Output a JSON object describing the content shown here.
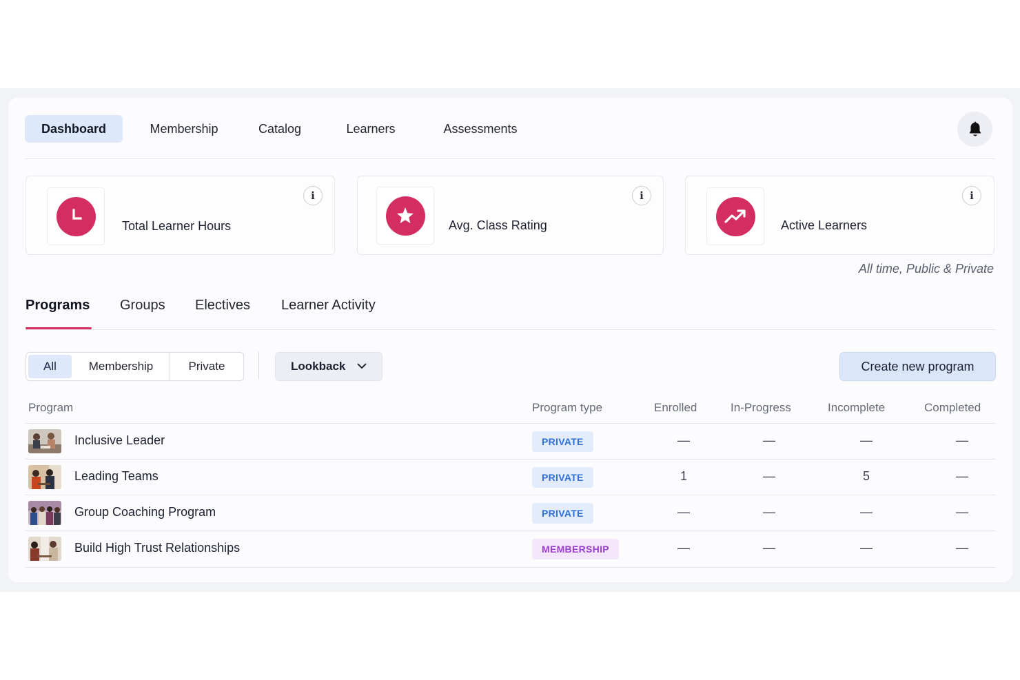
{
  "nav": {
    "items": [
      {
        "label": "Dashboard",
        "active": true
      },
      {
        "label": "Membership",
        "active": false
      },
      {
        "label": "Catalog",
        "active": false
      },
      {
        "label": "Learners",
        "active": false
      },
      {
        "label": "Assessments",
        "active": false
      }
    ],
    "bell_icon": "bell-icon"
  },
  "stats": {
    "cards": [
      {
        "label": "Total Learner Hours",
        "icon": "clock-icon",
        "info_icon": "info-icon"
      },
      {
        "label": "Avg. Class Rating",
        "icon": "star-icon",
        "info_icon": "info-icon"
      },
      {
        "label": "Active Learners",
        "icon": "trending-up-icon",
        "info_icon": "info-icon"
      }
    ],
    "caption": "All time, Public & Private",
    "accent_color": "#d42d62"
  },
  "tabs": [
    {
      "label": "Programs",
      "active": true
    },
    {
      "label": "Groups",
      "active": false
    },
    {
      "label": "Electives",
      "active": false
    },
    {
      "label": "Learner Activity",
      "active": false
    }
  ],
  "filters": {
    "segments": [
      {
        "label": "All",
        "active": true
      },
      {
        "label": "Membership",
        "active": false
      },
      {
        "label": "Private",
        "active": false
      }
    ],
    "lookback": {
      "label": "Lookback",
      "icon": "chevron-down-icon"
    },
    "create_button": "Create new program"
  },
  "table": {
    "headers": {
      "program": "Program",
      "type": "Program type",
      "enrolled": "Enrolled",
      "in_progress": "In-Progress",
      "incomplete": "Incomplete",
      "completed": "Completed"
    },
    "rows": [
      {
        "name": "Inclusive Leader",
        "type": "PRIVATE",
        "type_key": "private",
        "enrolled": "—",
        "in_progress": "—",
        "incomplete": "—",
        "completed": "—"
      },
      {
        "name": "Leading Teams",
        "type": "PRIVATE",
        "type_key": "private",
        "enrolled": "1",
        "in_progress": "—",
        "incomplete": "5",
        "completed": "—"
      },
      {
        "name": "Group Coaching Program",
        "type": "PRIVATE",
        "type_key": "private",
        "enrolled": "—",
        "in_progress": "—",
        "incomplete": "—",
        "completed": "—"
      },
      {
        "name": "Build High Trust Relationships",
        "type": "MEMBERSHIP",
        "type_key": "membership",
        "enrolled": "—",
        "in_progress": "—",
        "incomplete": "—",
        "completed": "—"
      }
    ]
  }
}
